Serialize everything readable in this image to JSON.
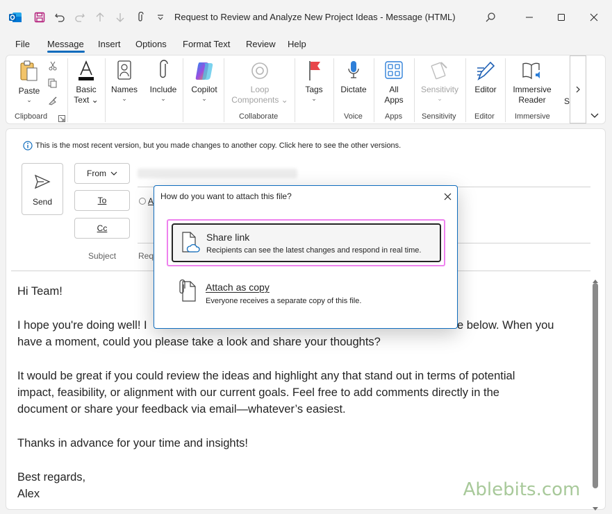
{
  "window": {
    "title": "Request to Review and Analyze New Project Ideas  -  Message (HTML)"
  },
  "menu": {
    "tabs": [
      {
        "label": "File"
      },
      {
        "label": "Message"
      },
      {
        "label": "Insert"
      },
      {
        "label": "Options"
      },
      {
        "label": "Format Text"
      },
      {
        "label": "Review"
      },
      {
        "label": "Help"
      }
    ],
    "active": "Message"
  },
  "ribbon": {
    "buttons": {
      "paste": "Paste",
      "basic_text_1": "Basic",
      "basic_text_2": "Text",
      "names": "Names",
      "include": "Include",
      "copilot": "Copilot",
      "loop_1": "Loop",
      "loop_2": "Components",
      "tags": "Tags",
      "dictate": "Dictate",
      "all_apps_1": "All",
      "all_apps_2": "Apps",
      "sensitivity": "Sensitivity",
      "editor": "Editor",
      "immersive_1": "Immersive",
      "immersive_2": "Reader",
      "more_partial": "S"
    },
    "groups": {
      "clipboard": "Clipboard",
      "collaborate": "Collaborate",
      "voice": "Voice",
      "apps": "Apps",
      "sensitivity": "Sensitivity",
      "editor": "Editor",
      "immersive": "Immersive"
    }
  },
  "compose": {
    "info_text": "This is the most recent version, but you made changes to another copy. Click here to see the other versions.",
    "send": "Send",
    "from": "From",
    "to": "To",
    "cc": "Cc",
    "subject_label": "Subject",
    "subject_partial": "Req",
    "attach_partial": "A"
  },
  "body": {
    "greeting": "Hi Team!",
    "p1_line1": "I hope you're doing well! I",
    "p1_line1_end": "e below. When you",
    "p1_line2": "have a moment, could you please take a look and share your thoughts?",
    "p2_line1": "It would be great if you could review the ideas and highlight any that stand out in terms of potential",
    "p2_line2": "impact, feasibility, or alignment with our current goals. Feel free to add comments directly in the",
    "p2_line3": "document or share your feedback via email—whatever’s easiest.",
    "p3": "Thanks in advance for your time and insights!",
    "closing": "Best regards,",
    "name": "Alex"
  },
  "dialog": {
    "title": "How do you want to attach this file?",
    "option1_title": "Share link",
    "option1_sub": "Recipients can see the latest changes and respond in real time.",
    "option2_title": "Attach as copy",
    "option2_sub": "Everyone receives a separate copy of this file."
  },
  "watermark": "Ablebits.com",
  "colors": {
    "accent": "#0f6cbd",
    "highlight": "#ee82ee"
  }
}
